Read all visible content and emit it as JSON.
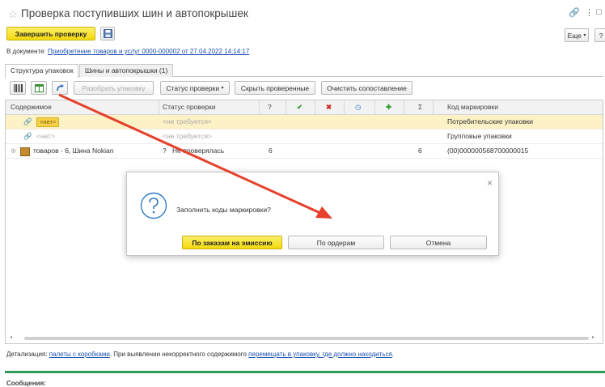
{
  "window": {
    "title": "Проверка поступивших шин и автопокрышек",
    "icons": {
      "star": "star-icon",
      "link": "link-icon",
      "more": "more-vert-icon",
      "maximize": "maximize-icon"
    }
  },
  "toolbar": {
    "finish_label": "Завершить проверку",
    "more_label": "Еще",
    "help_label": "?"
  },
  "document_line": {
    "prefix": "В документе:",
    "link": "Приобретение товаров и услуг 0000-000002 от 27.04.2022 14:14:17"
  },
  "tabs": [
    {
      "label": "Структура упаковок"
    },
    {
      "label": "Шины и автопокрышки (1)"
    }
  ],
  "grid_toolbar": {
    "unpack_label": "Разобрать упаковку",
    "status_label": "Статус проверки",
    "hide_checked_label": "Скрыть проверенные",
    "clear_match_label": "Очистить сопоставление"
  },
  "table": {
    "columns": [
      "Содержимое",
      "Статус проверки",
      "?",
      "✔",
      "✖",
      "◷",
      "✚",
      "Σ",
      "Код маркировки"
    ],
    "rows": [
      {
        "content": "<нет>",
        "status": "<не требуется>",
        "q": "",
        "sum": "",
        "code": "Потребительские упаковки"
      },
      {
        "content": "<нет>",
        "status": "<не требуется>",
        "q": "",
        "sum": "",
        "code": "Групповые упаковки"
      },
      {
        "content": "товаров - 6, Шина Nokian",
        "status": "Не проверялась",
        "status_icon": "?",
        "q": "6",
        "sum": "6",
        "code": "(00)000000568700000015"
      }
    ]
  },
  "dialog": {
    "message": "Заполнить коды маркировки?",
    "btn_emission": "По заказам на эмиссию",
    "btn_orders": "По ордерам",
    "btn_cancel": "Отмена",
    "close": "×"
  },
  "footer": {
    "prefix": "Детализация:",
    "link1": "палеты с коробками",
    "middle": ". При выявлении некорректного содержимого",
    "link2": "перемещать в упаковку, где должно находиться",
    "end": "."
  },
  "messages_label": "Сообщения:",
  "colors": {
    "accent_yellow": "#f3d90d",
    "link": "#1a4fb0",
    "arrow": "#e5412d",
    "green": "#2e9b57"
  }
}
